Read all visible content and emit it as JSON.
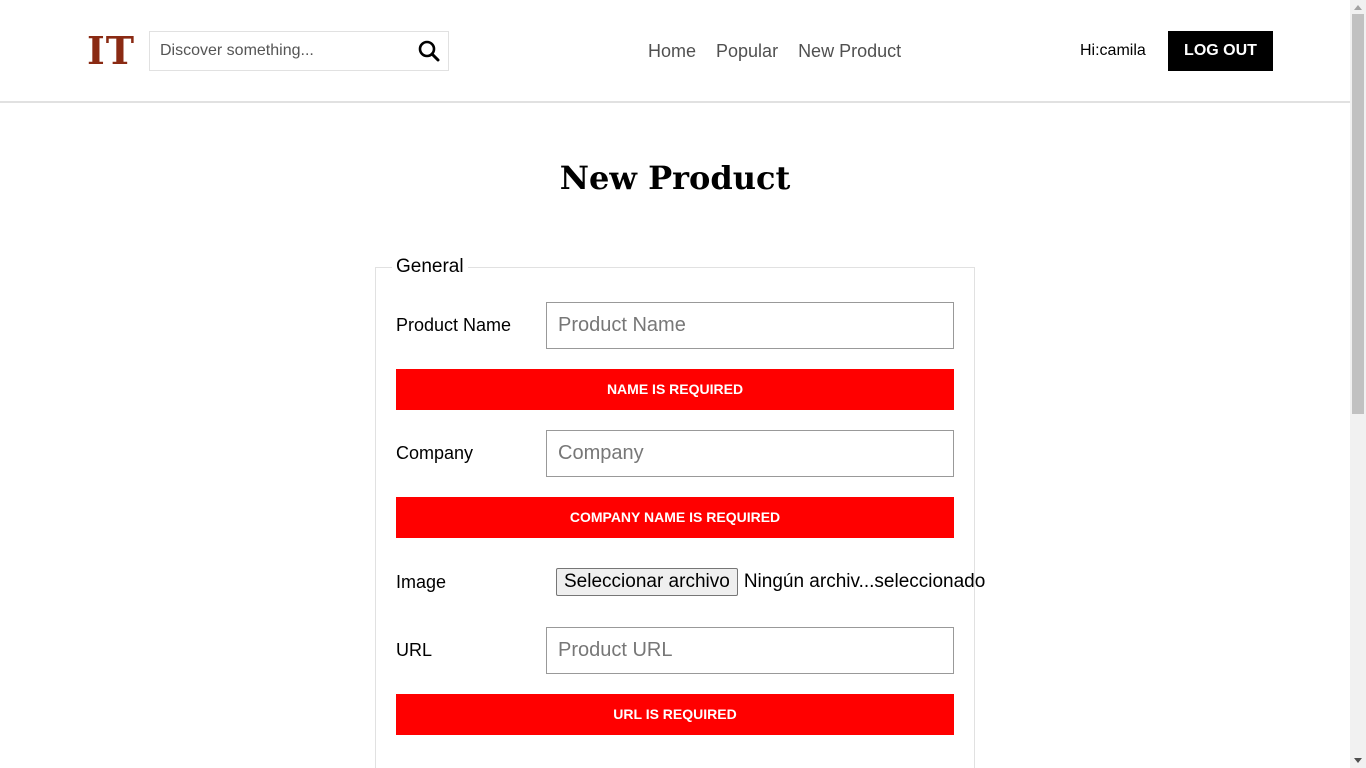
{
  "header": {
    "logo": "IT",
    "search_placeholder": "Discover something...",
    "nav": [
      "Home",
      "Popular",
      "New Product"
    ],
    "greeting": "Hi:camila",
    "logout_label": "LOG OUT"
  },
  "page": {
    "title": "New Product"
  },
  "form": {
    "legend": "General",
    "product_name": {
      "label": "Product Name",
      "placeholder": "Product Name",
      "error": "NAME IS REQUIRED"
    },
    "company": {
      "label": "Company",
      "placeholder": "Company",
      "error": "COMPANY NAME IS REQUIRED"
    },
    "image": {
      "label": "Image",
      "button_label": "Seleccionar archivo",
      "status": "Ningún archiv...seleccionado"
    },
    "url": {
      "label": "URL",
      "placeholder": "Product URL",
      "error": "URL IS REQUIRED"
    }
  },
  "icons": {
    "search": "search-icon",
    "logo": "logo"
  },
  "colors": {
    "logo": "#8a2a13",
    "error_bg": "#ff0000",
    "logout_bg": "#000000",
    "nav_text": "#505050"
  }
}
